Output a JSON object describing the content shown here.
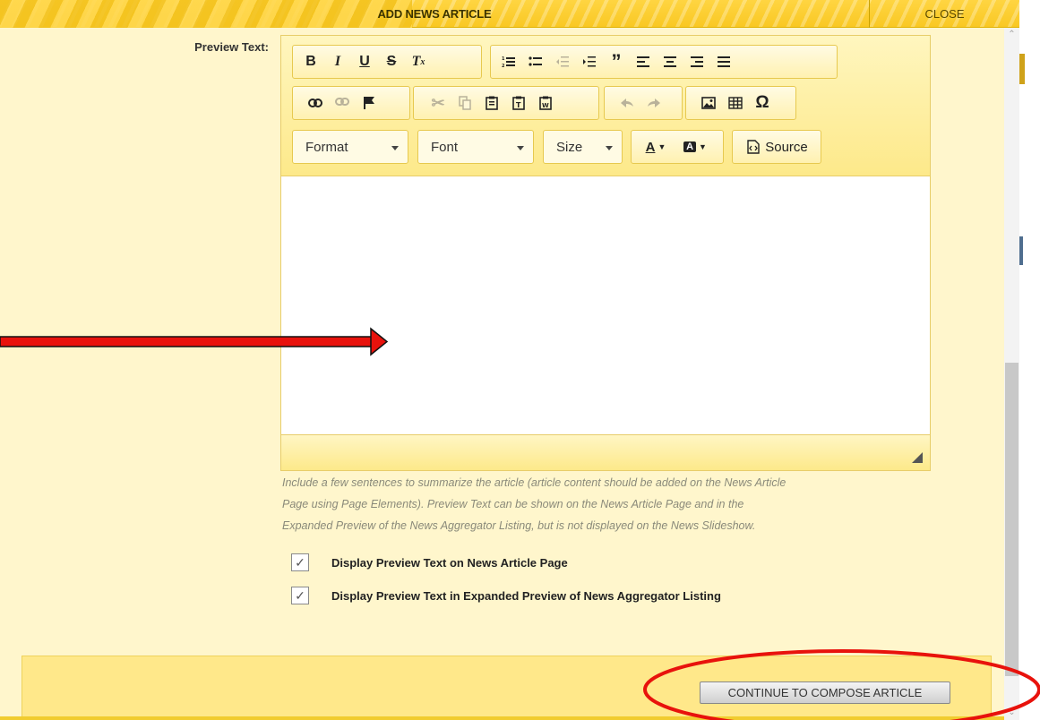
{
  "modal": {
    "title": "ADD NEWS ARTICLE",
    "close_label": "CLOSE"
  },
  "form": {
    "preview_label": "Preview Text:",
    "help_line1": "Include a few sentences to summarize the article (article content should be added on the News Article",
    "help_line2": "Page using Page Elements). Preview Text can be shown on the News Article Page and in the",
    "help_line3": "Expanded Preview of the News Aggregator Listing, but is not displayed on the News Slideshow.",
    "check1_label": "Display Preview Text on News Article Page",
    "check1_checked": true,
    "check2_label": "Display Preview Text in Expanded Preview of News Aggregator Listing",
    "check2_checked": true,
    "continue_label": "CONTINUE TO COMPOSE ARTICLE"
  },
  "toolbar": {
    "format_label": "Format",
    "font_label": "Font",
    "size_label": "Size",
    "source_label": "Source",
    "text_color_label": "A",
    "bg_color_label": "A"
  },
  "colors": {
    "accent": "#f9c823",
    "panel": "#fff6cc",
    "annotation_red": "#e8120c"
  }
}
